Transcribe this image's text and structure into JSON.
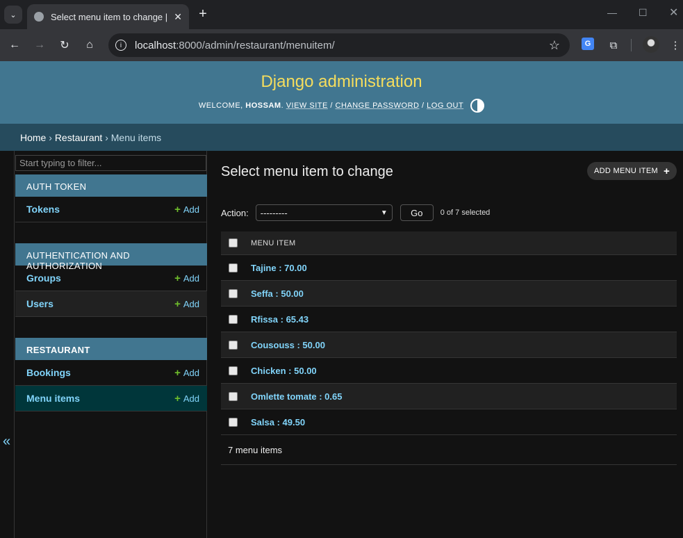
{
  "browser": {
    "tab_title": "Select menu item to change | Dj",
    "url_host": "localhost",
    "url_path": ":8000/admin/restaurant/menuitem/"
  },
  "header": {
    "branding": "Django administration",
    "welcome": "Welcome,",
    "username": "hossam",
    "view_site": "View site",
    "change_password": "Change password",
    "log_out": "Log out"
  },
  "breadcrumbs": {
    "home": "Home",
    "app": "Restaurant",
    "current": "Menu items",
    "separator": "›"
  },
  "sidebar": {
    "filter_placeholder": "Start typing to filter...",
    "add_label": "Add",
    "modules": [
      {
        "caption": "Auth Token",
        "models": [
          {
            "name": "Tokens"
          }
        ]
      },
      {
        "caption": "Authentication and Authorization",
        "models": [
          {
            "name": "Groups"
          },
          {
            "name": "Users"
          }
        ]
      },
      {
        "caption": "Restaurant",
        "models": [
          {
            "name": "Bookings"
          },
          {
            "name": "Menu items"
          }
        ]
      }
    ],
    "toggle_icon": "«"
  },
  "main": {
    "title": "Select menu item to change",
    "add_button": "Add menu item",
    "action_label": "Action:",
    "action_selected": "---------",
    "go_label": "Go",
    "counter": "0 of 7 selected",
    "column_header": "Menu item",
    "items": [
      "Tajine : 70.00",
      "Seffa : 50.00",
      "Rfissa : 65.43",
      "Cousouss : 50.00",
      "Chicken : 50.00",
      "Omlette tomate : 0.65",
      "Salsa : 49.50"
    ],
    "paginator": "7 menu items"
  },
  "colors": {
    "header_bg": "#417690",
    "branding": "#f5dd5d",
    "breadcrumbs_bg": "#264b5d",
    "link": "#81d4fa",
    "add_plus": "#70bf2b",
    "selected_row": "#00363a"
  }
}
